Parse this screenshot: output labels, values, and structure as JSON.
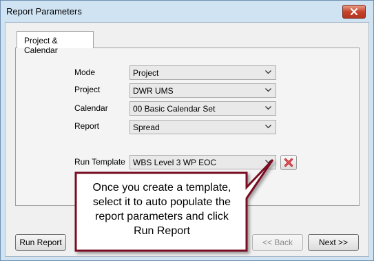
{
  "window": {
    "title": "Report Parameters"
  },
  "tab": {
    "label": "Project & Calendar"
  },
  "fields": {
    "mode": {
      "label": "Mode",
      "value": "Project"
    },
    "project": {
      "label": "Project",
      "value": "DWR UMS"
    },
    "calendar": {
      "label": "Calendar",
      "value": "00 Basic Calendar Set"
    },
    "report": {
      "label": "Report",
      "value": "Spread"
    },
    "run_template": {
      "label": "Run Template",
      "value": "WBS Level 3 WP EOC"
    }
  },
  "buttons": {
    "run_report": "Run Report",
    "back": "<< Back",
    "next": "Next >>"
  },
  "callout": {
    "lines": [
      "Once you create a template,",
      "select it to auto populate the",
      "report parameters and click",
      "Run Report"
    ]
  },
  "colors": {
    "close_button": "#c7422c",
    "delete_icon": "#c0282d",
    "callout_border": "#7a1020"
  },
  "icons": {
    "close": "close-icon",
    "delete": "delete-x-icon",
    "dropdown": "chevron-down-icon"
  }
}
